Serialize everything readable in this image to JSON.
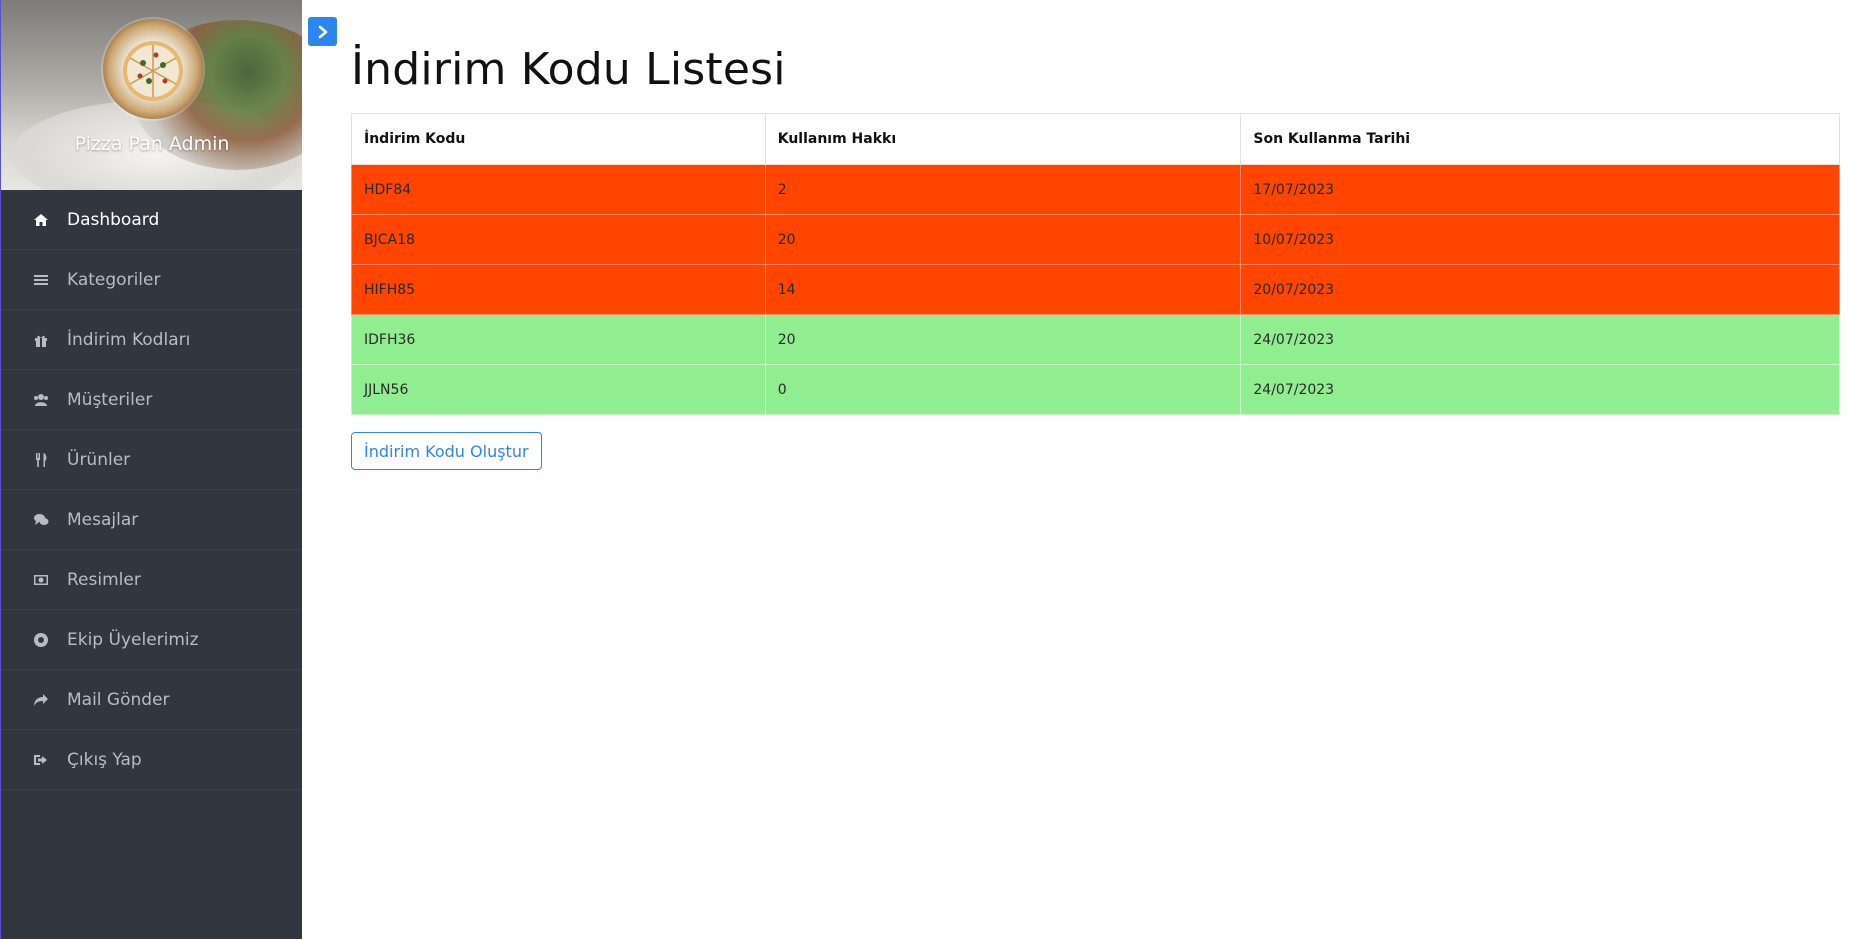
{
  "sidebar": {
    "brand": "Pizza Pan Admin",
    "items": [
      {
        "label": "Dashboard",
        "icon": "home-icon",
        "active": true
      },
      {
        "label": "Kategoriler",
        "icon": "list-icon"
      },
      {
        "label": "İndirim Kodları",
        "icon": "gift-icon"
      },
      {
        "label": "Müşteriler",
        "icon": "users-icon"
      },
      {
        "label": "Ürünler",
        "icon": "cutlery-icon"
      },
      {
        "label": "Mesajlar",
        "icon": "comments-icon"
      },
      {
        "label": "Resimler",
        "icon": "image-icon"
      },
      {
        "label": "Ekip Üyelerimiz",
        "icon": "life-ring-icon"
      },
      {
        "label": "Mail Gönder",
        "icon": "share-icon"
      },
      {
        "label": "Çıkış Yap",
        "icon": "sign-out-icon"
      }
    ]
  },
  "toggle": {
    "icon": "chevron-right-icon"
  },
  "page": {
    "title": "İndirim Kodu Listesi"
  },
  "table": {
    "headers": [
      "İndirim Kodu",
      "Kullanım Hakkı",
      "Son Kullanma Tarihi"
    ],
    "rows": [
      {
        "code": "HDF84",
        "uses": "2",
        "expiry": "17/07/2023",
        "status": "expired"
      },
      {
        "code": "BJCA18",
        "uses": "20",
        "expiry": "10/07/2023",
        "status": "expired"
      },
      {
        "code": "HIFH85",
        "uses": "14",
        "expiry": "20/07/2023",
        "status": "expired"
      },
      {
        "code": "IDFH36",
        "uses": "20",
        "expiry": "24/07/2023",
        "status": "valid"
      },
      {
        "code": "JJLN56",
        "uses": "0",
        "expiry": "24/07/2023",
        "status": "valid"
      }
    ]
  },
  "actions": {
    "create_label": "İndirim Kodu Oluştur"
  },
  "colors": {
    "expired_row": "#ff4500",
    "valid_row": "#90ee90",
    "accent": "#2b86f0",
    "sidebar_bg": "#32373f"
  }
}
